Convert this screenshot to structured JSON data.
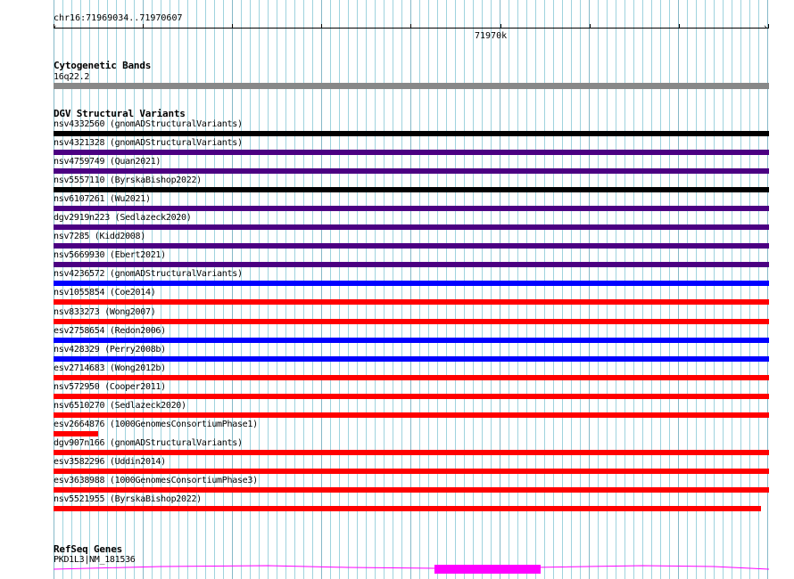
{
  "ruler": {
    "coordinates": "chr16:71969034..71970607",
    "tick_label": "71970k"
  },
  "cytoband": {
    "title": "Cytogenetic Bands",
    "band_label": "16q22.2",
    "color": "#888888"
  },
  "dgv": {
    "title": "DGV Structural Variants",
    "variants": [
      {
        "label": "nsv4332560 (gnomADStructuralVariants)",
        "color": "#000000"
      },
      {
        "label": "nsv4321328 (gnomADStructuralVariants)",
        "color": "#4b0082"
      },
      {
        "label": "nsv4759749 (Quan2021)",
        "color": "#4b0082"
      },
      {
        "label": "nsv5557110 (ByrskaBishop2022)",
        "color": "#000000"
      },
      {
        "label": "nsv6107261 (Wu2021)",
        "color": "#4b0082"
      },
      {
        "label": "dgv2919n223 (Sedlazeck2020)",
        "color": "#4b0082"
      },
      {
        "label": "nsv7285 (Kidd2008)",
        "color": "#4b0082"
      },
      {
        "label": "nsv5669930 (Ebert2021)",
        "color": "#4b0082"
      },
      {
        "label": "nsv4236572 (gnomADStructuralVariants)",
        "color": "#0000ff"
      },
      {
        "label": "nsv1055854 (Coe2014)",
        "color": "#ff0000"
      },
      {
        "label": "nsv833273 (Wong2007)",
        "color": "#ff0000"
      },
      {
        "label": "esv2758654 (Redon2006)",
        "color": "#0000ff"
      },
      {
        "label": "nsv428329 (Perry2008b)",
        "color": "#0000ff"
      },
      {
        "label": "esv2714683 (Wong2012b)",
        "color": "#ff0000"
      },
      {
        "label": "nsv572950 (Cooper2011)",
        "color": "#ff0000"
      },
      {
        "label": "nsv6510270 (Sedlazeck2020)",
        "color": "#ff0000"
      },
      {
        "label": "esv2664876 (1000GenomesConsortiumPhase1)",
        "color": "#ff0000"
      },
      {
        "label": "dgv907n166 (gnomADStructuralVariants)",
        "color": "#ff0000"
      },
      {
        "label": "esv3582296 (Uddin2014)",
        "color": "#ff0000"
      },
      {
        "label": "esv3638988 (1000GenomesConsortiumPhase3)",
        "color": "#ff0000"
      },
      {
        "label": "nsv5521955 (ByrskaBishop2022)",
        "color": "#ff0000"
      }
    ]
  },
  "refseq": {
    "title": "RefSeq Genes",
    "gene_label": "PKD1L3|NM_181536",
    "color": "#ff00ff"
  }
}
